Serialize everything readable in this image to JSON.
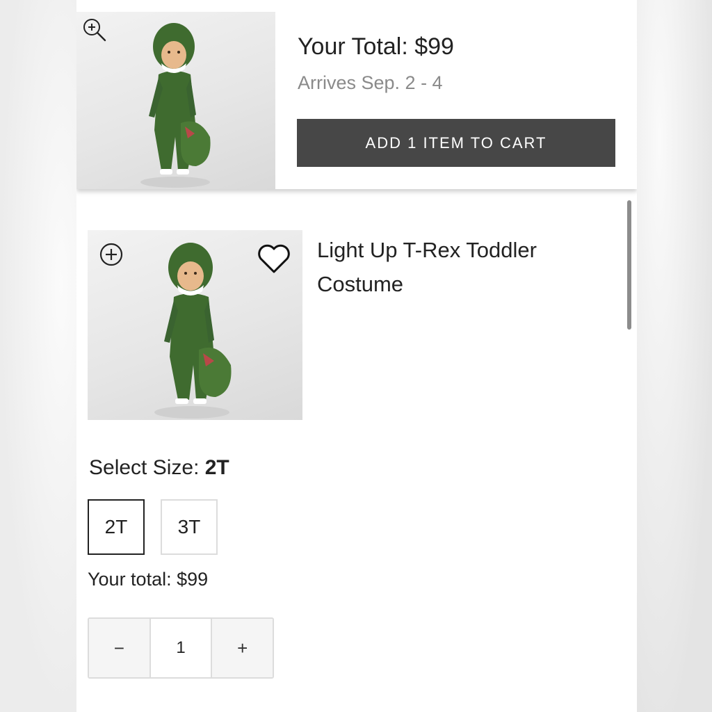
{
  "summary": {
    "total_label": "Your Total: $99",
    "arrival": "Arrives Sep. 2 - 4",
    "add_to_cart": "ADD 1 ITEM TO CART",
    "zoom_icon": "zoom-in-icon"
  },
  "product": {
    "title": "Light Up T-Rex Toddler Costume",
    "add_icon": "plus-circle-icon",
    "wishlist_icon": "heart-icon",
    "size": {
      "label": "Select Size:",
      "selected_value": "2T",
      "options": [
        "2T",
        "3T"
      ]
    },
    "total_line": "Your total: $99",
    "quantity": {
      "decrement": "−",
      "value": "1",
      "increment": "+"
    }
  },
  "colors": {
    "button_dark": "#474747",
    "costume_green": "#3f6b2f",
    "text": "#222222",
    "muted_text": "#8a8a8a",
    "border": "#dcdcdc"
  }
}
